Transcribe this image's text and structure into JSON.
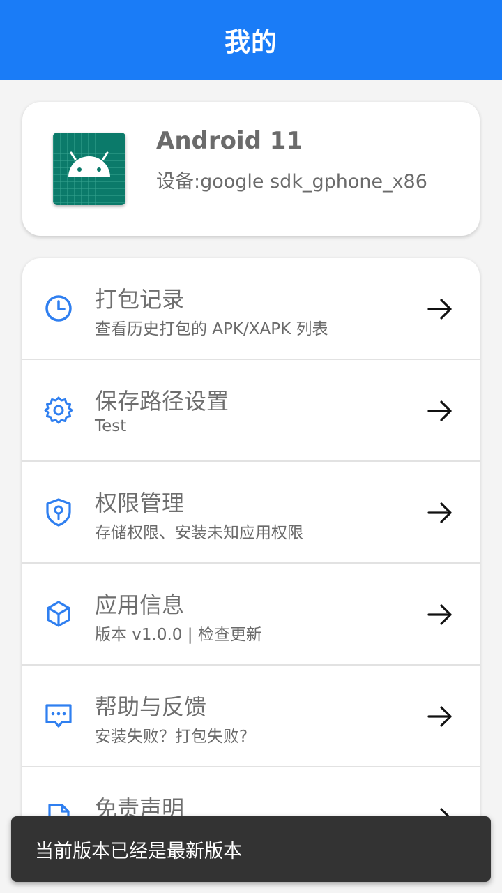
{
  "header": {
    "title": "我的"
  },
  "device": {
    "os": "Android 11",
    "name": "设备:google sdk_gphone_x86",
    "icon": "android-app-icon"
  },
  "menu": {
    "items": [
      {
        "title": "打包记录",
        "subtitle": "查看历史打包的 APK/XAPK 列表",
        "icon": "clock-icon"
      },
      {
        "title": "保存路径设置",
        "subtitle": "Test",
        "icon": "gear-icon"
      },
      {
        "title": "权限管理",
        "subtitle": "存储权限、安装未知应用权限",
        "icon": "shield-key-icon"
      },
      {
        "title": "应用信息",
        "subtitle": "版本 v1.0.0 | 检查更新",
        "icon": "cube-icon"
      },
      {
        "title": "帮助与反馈",
        "subtitle": "安装失败？打包失败?",
        "icon": "chat-icon"
      },
      {
        "title": "免责声明",
        "subtitle": "",
        "icon": "document-icon"
      }
    ]
  },
  "toast": {
    "message": "当前版本已经是最新版本"
  },
  "colors": {
    "primary": "#1a7cf7",
    "icon_blue": "#2f7ff0",
    "text_gray": "#6e6e6e",
    "toast_bg": "#333333"
  }
}
